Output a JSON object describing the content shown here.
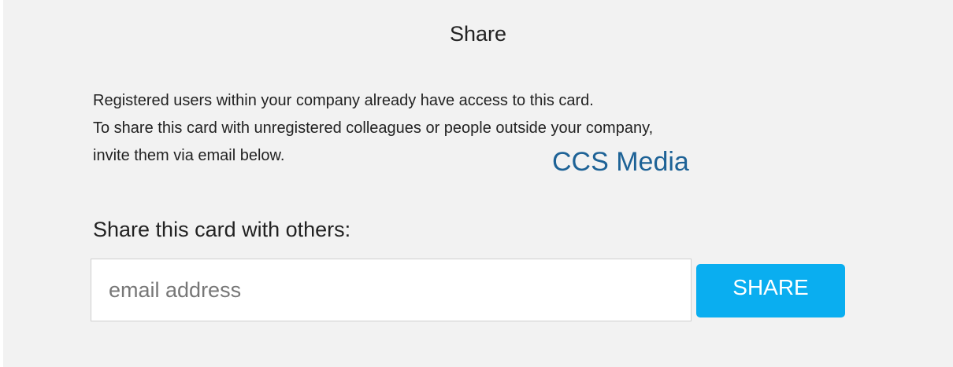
{
  "dialog": {
    "title": "Share",
    "description_lines": [
      "Registered users within your company already have access to this card.",
      "To share this card with unregistered colleagues or people outside your company,",
      "invite them via email below."
    ],
    "watermark": "CCS Media"
  },
  "share_form": {
    "label": "Share this card with others:",
    "email_placeholder": "email address",
    "email_value": "",
    "button_label": "SHARE"
  },
  "colors": {
    "panel_background": "#f2f2f2",
    "button_accent": "#0aaef0",
    "watermark": "#1d6296"
  }
}
